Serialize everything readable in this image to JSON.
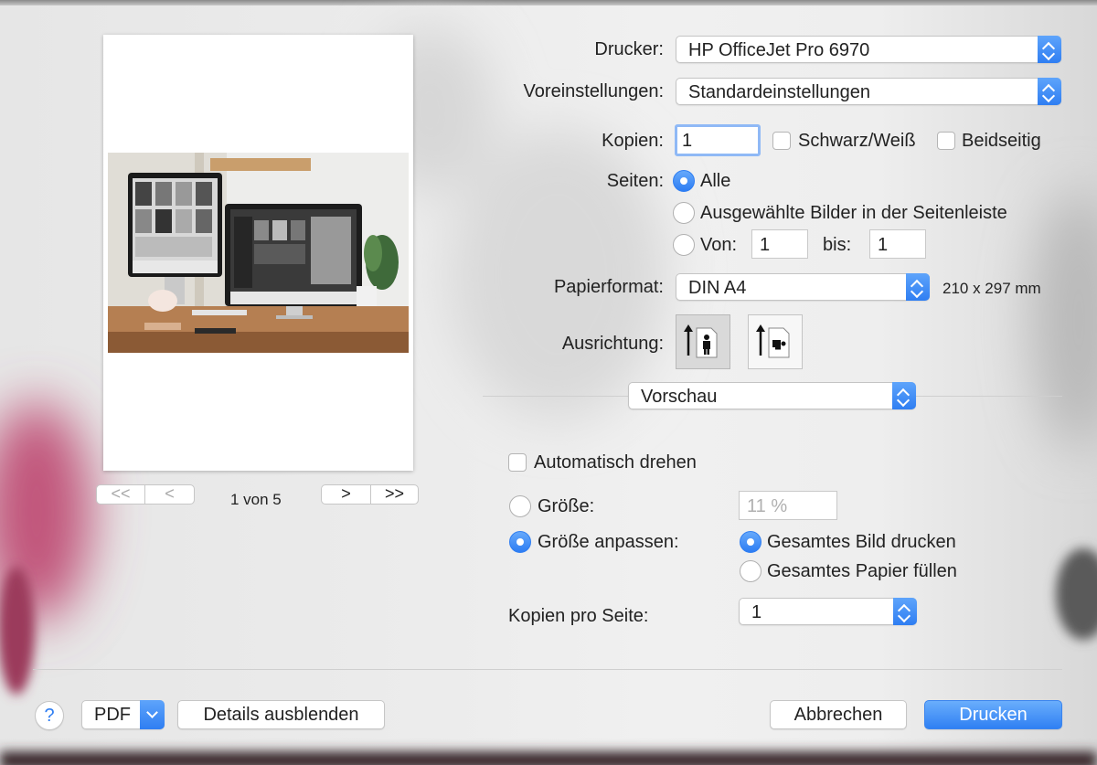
{
  "printer": {
    "label": "Drucker:",
    "value": "HP OfficeJet Pro 6970"
  },
  "presets": {
    "label": "Voreinstellungen:",
    "value": "Standardeinstellungen"
  },
  "copies": {
    "label": "Kopien:",
    "value": "1",
    "bw_label": "Schwarz/Weiß",
    "duplex_label": "Beidseitig"
  },
  "pages": {
    "label": "Seiten:",
    "all_label": "Alle",
    "selected_label": "Ausgewählte Bilder in der Seitenleiste",
    "from_label": "Von:",
    "from_value": "1",
    "to_label": "bis:",
    "to_value": "1"
  },
  "paper": {
    "label": "Papierformat:",
    "value": "DIN A4",
    "size": "210 x 297 mm"
  },
  "orientation": {
    "label": "Ausrichtung:"
  },
  "section_select": {
    "value": "Vorschau"
  },
  "preview_options": {
    "auto_rotate_label": "Automatisch drehen",
    "size_label": "Größe:",
    "size_value": "11 %",
    "fit_label": "Größe anpassen:",
    "print_whole_label": "Gesamtes Bild drucken",
    "fill_paper_label": "Gesamtes Papier füllen",
    "copies_per_page_label": "Kopien pro Seite:",
    "copies_per_page_value": "1"
  },
  "preview_nav": {
    "first": "<<",
    "prev": "<",
    "page_text": "1 von 5",
    "next": ">",
    "last": ">>"
  },
  "footer": {
    "help": "?",
    "pdf": "PDF",
    "details": "Details ausblenden",
    "cancel": "Abbrechen",
    "print": "Drucken"
  },
  "colors": {
    "accent": "#2f7ef2",
    "window_bg": "#ececec",
    "separator": "#cfcfcf"
  },
  "icons": {
    "portrait": "portrait-orientation-icon",
    "landscape": "landscape-orientation-icon",
    "popup_arrows": "chevron-updown-icon"
  }
}
